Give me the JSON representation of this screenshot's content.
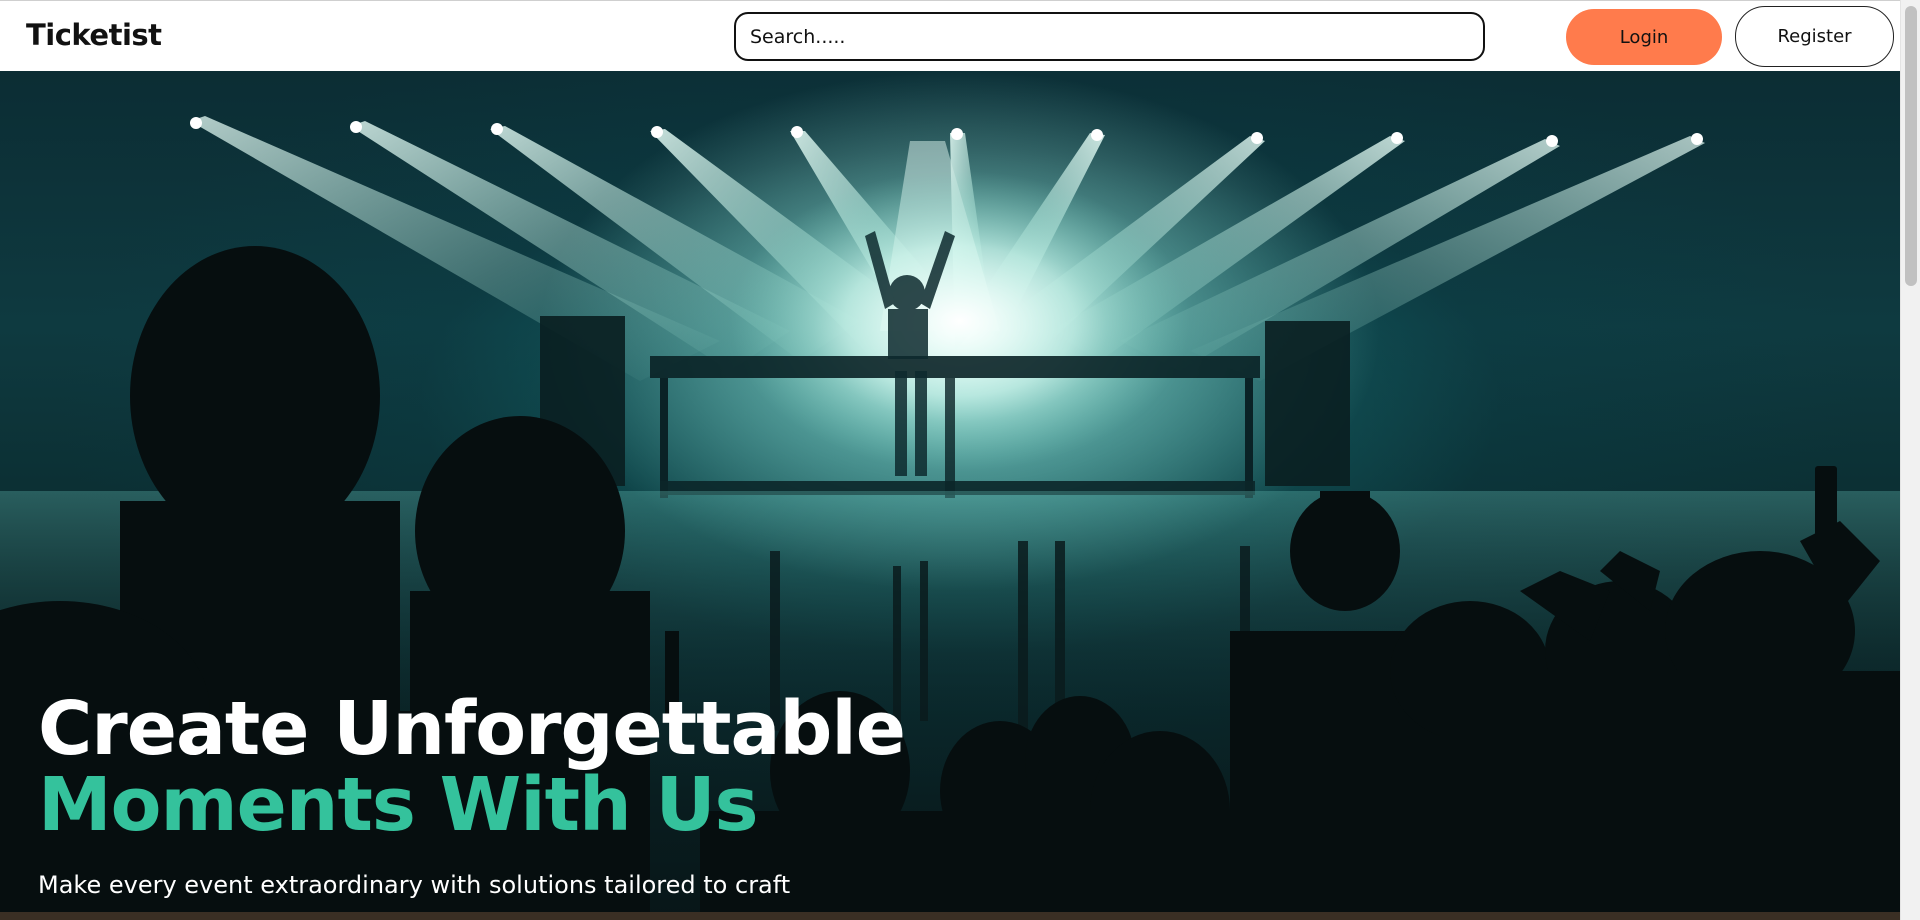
{
  "header": {
    "brand": "Ticketist",
    "search_placeholder": "Search.....",
    "login_label": "Login",
    "register_label": "Register"
  },
  "hero": {
    "headline_line1": "Create Unforgettable",
    "headline_line2": "Moments With Us",
    "subtitle": "Make every event extraordinary with solutions tailored to craft"
  },
  "colors": {
    "accent_green": "#34c29c",
    "login_orange": "#ff7b4c"
  },
  "icons": {
    "hero_image": "concert-photo"
  }
}
